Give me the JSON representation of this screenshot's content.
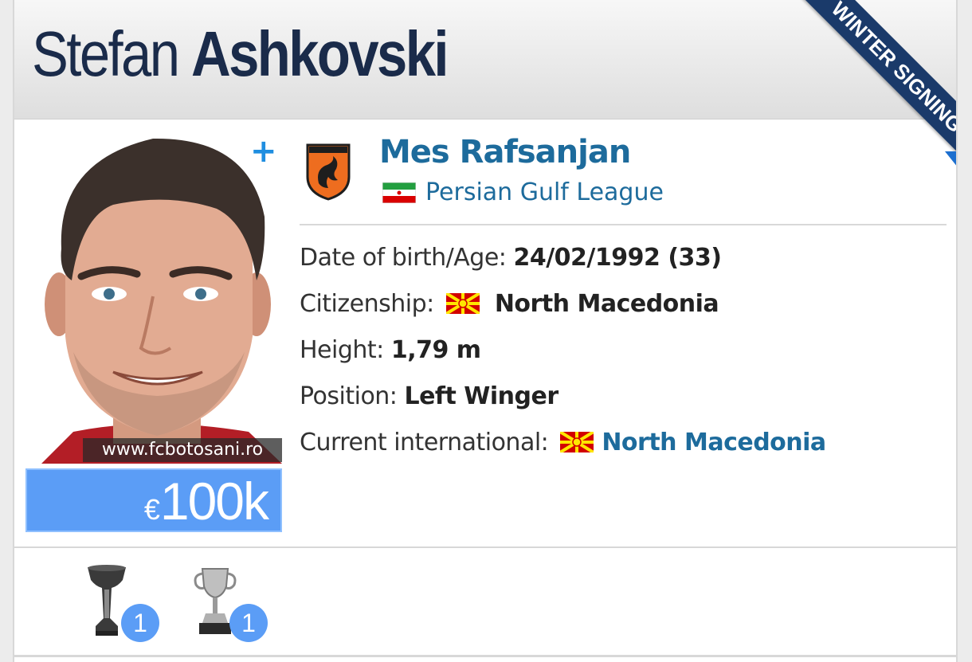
{
  "player": {
    "first_name": "Stefan",
    "last_name": "Ashkovski",
    "ribbon": "WINTER SIGNING",
    "photo_credit": "www.fcbotosani.ro",
    "market_value_currency": "€",
    "market_value_amount": "100k"
  },
  "club": {
    "name": "Mes Rafsanjan",
    "league": "Persian Gulf League",
    "league_flag_icon": "iran-flag-icon"
  },
  "info": {
    "dob_label": "Date of birth/Age:",
    "dob_value": "24/02/1992 (33)",
    "citizenship_label": "Citizenship:",
    "citizenship_value": "North Macedonia",
    "height_label": "Height:",
    "height_value": "1,79 m",
    "position_label": "Position:",
    "position_value": "Left Winger",
    "intl_label": "Current international:",
    "intl_value": "North Macedonia"
  },
  "trophies": [
    {
      "icon": "cup-trophy-icon",
      "count": "1"
    },
    {
      "icon": "silver-cup-trophy-icon",
      "count": "1"
    }
  ],
  "colors": {
    "accent_blue": "#1d6b9c",
    "market_value_bg": "#5b9df6",
    "ribbon_bg": "#1a3a6a",
    "name_color": "#1a2b4a"
  }
}
